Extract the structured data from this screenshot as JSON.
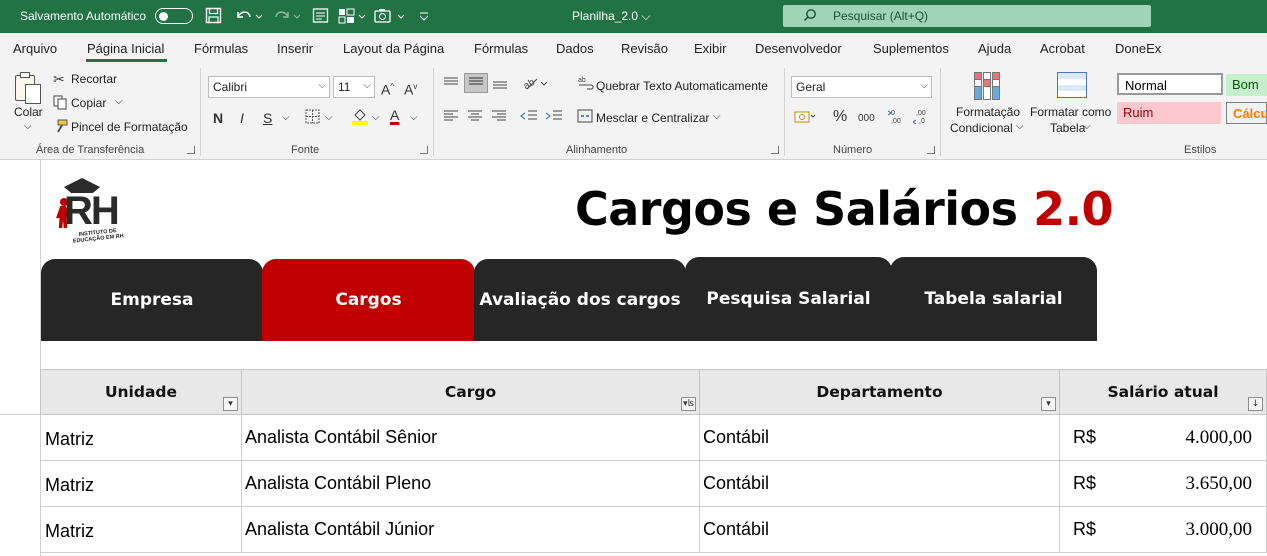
{
  "titlebar": {
    "autosave_label": "Salvamento Automático",
    "doc_title": "Planilha_2.0",
    "doc_title_arrow": "⌄",
    "search_placeholder": "Pesquisar (Alt+Q)",
    "icons": [
      "toggle-off-icon",
      "save-icon",
      "undo-icon",
      "redo-icon",
      "form-icon",
      "pivot-icon",
      "camera-icon",
      "customize-qat-icon",
      "search-icon"
    ]
  },
  "menu": {
    "items": [
      "Arquivo",
      "Página Inicial",
      "Fórmulas",
      "Inserir",
      "Layout da Página",
      "Fórmulas",
      "Dados",
      "Revisão",
      "Exibir",
      "Desenvolvedor",
      "Suplementos",
      "Ajuda",
      "Acrobat",
      "DoneEx"
    ],
    "active": "Página Inicial"
  },
  "ribbon": {
    "clipboard": {
      "paste": "Colar",
      "cut": "Recortar",
      "copy": "Copiar",
      "format_painter": "Pincel de Formatação",
      "group": "Área de Transferência"
    },
    "font": {
      "name": "Calibri",
      "size": "11",
      "bold": "N",
      "italic": "I",
      "underline": "S",
      "group": "Fonte"
    },
    "alignment": {
      "wrap": "Quebrar Texto Automaticamente",
      "merge": "Mesclar e Centralizar",
      "group": "Alinhamento"
    },
    "number": {
      "format": "Geral",
      "percent": "%",
      "thousands": "000",
      "group": "Número"
    },
    "styles": {
      "conditional_1": "Formatação",
      "conditional_2": "Condicional",
      "table_1": "Formatar como",
      "table_2": "Tabela",
      "normal": "Normal",
      "good": "Bom",
      "bad": "Ruim",
      "calc": "Cálcul",
      "group": "Estilos"
    }
  },
  "sheet": {
    "logo": {
      "letters": "RH",
      "subtitle_1": "INSTITUTO DE",
      "subtitle_2": "EDUCAÇÃO EM RH"
    },
    "title": "Cargos e Salários",
    "title_accent": "2.0",
    "nav": [
      {
        "label": "Empresa",
        "color": "#262626"
      },
      {
        "label": "Cargos",
        "color": "#c00000"
      },
      {
        "label": "Avaliação dos cargos",
        "color": "#262626"
      },
      {
        "label": "Pesquisa Salarial",
        "color": "#262626"
      },
      {
        "label": "Tabela salarial",
        "color": "#262626"
      }
    ],
    "headers": [
      "Unidade",
      "Cargo",
      "Departamento",
      "Salário atual"
    ],
    "rows": [
      {
        "unidade": "Matriz",
        "cargo": "Analista Contábil Sênior",
        "departamento": "Contábil",
        "currency": "R$",
        "salario": "4.000,00"
      },
      {
        "unidade": "Matriz",
        "cargo": "Analista Contábil Pleno",
        "departamento": "Contábil",
        "currency": "R$",
        "salario": "3.650,00"
      },
      {
        "unidade": "Matriz",
        "cargo": "Analista Contábil Júnior",
        "departamento": "Contábil",
        "currency": "R$",
        "salario": "3.000,00"
      }
    ]
  },
  "colors": {
    "excel_green": "#217346",
    "nav_dark": "#262626",
    "nav_active": "#c00000",
    "accent_red": "#c00000",
    "header_gray": "#e8e8e8"
  }
}
